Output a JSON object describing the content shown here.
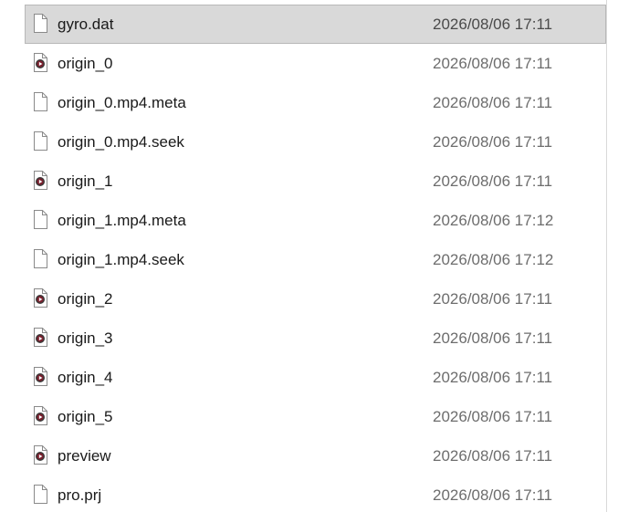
{
  "files": [
    {
      "name": "gyro.dat",
      "date": "2026/08/06 17:11",
      "icon": "document-icon",
      "selected": true
    },
    {
      "name": "origin_0",
      "date": "2026/08/06 17:11",
      "icon": "video-file-icon",
      "selected": false
    },
    {
      "name": "origin_0.mp4.meta",
      "date": "2026/08/06 17:11",
      "icon": "document-icon",
      "selected": false
    },
    {
      "name": "origin_0.mp4.seek",
      "date": "2026/08/06 17:11",
      "icon": "document-icon",
      "selected": false
    },
    {
      "name": "origin_1",
      "date": "2026/08/06 17:11",
      "icon": "video-file-icon",
      "selected": false
    },
    {
      "name": "origin_1.mp4.meta",
      "date": "2026/08/06 17:12",
      "icon": "document-icon",
      "selected": false
    },
    {
      "name": "origin_1.mp4.seek",
      "date": "2026/08/06 17:12",
      "icon": "document-icon",
      "selected": false
    },
    {
      "name": "origin_2",
      "date": "2026/08/06 17:11",
      "icon": "video-file-icon",
      "selected": false
    },
    {
      "name": "origin_3",
      "date": "2026/08/06 17:11",
      "icon": "video-file-icon",
      "selected": false
    },
    {
      "name": "origin_4",
      "date": "2026/08/06 17:11",
      "icon": "video-file-icon",
      "selected": false
    },
    {
      "name": "origin_5",
      "date": "2026/08/06 17:11",
      "icon": "video-file-icon",
      "selected": false
    },
    {
      "name": "preview",
      "date": "2026/08/06 17:11",
      "icon": "video-file-icon",
      "selected": false
    },
    {
      "name": "pro.prj",
      "date": "2026/08/06 17:11",
      "icon": "document-icon",
      "selected": false
    }
  ],
  "colors": {
    "selection_bg": "#d9d9d9",
    "selection_border": "#b8b8b8",
    "name_text": "#1a1a1a",
    "date_text": "#6d6d6d",
    "video_icon_accent": "#7a1e2c"
  }
}
